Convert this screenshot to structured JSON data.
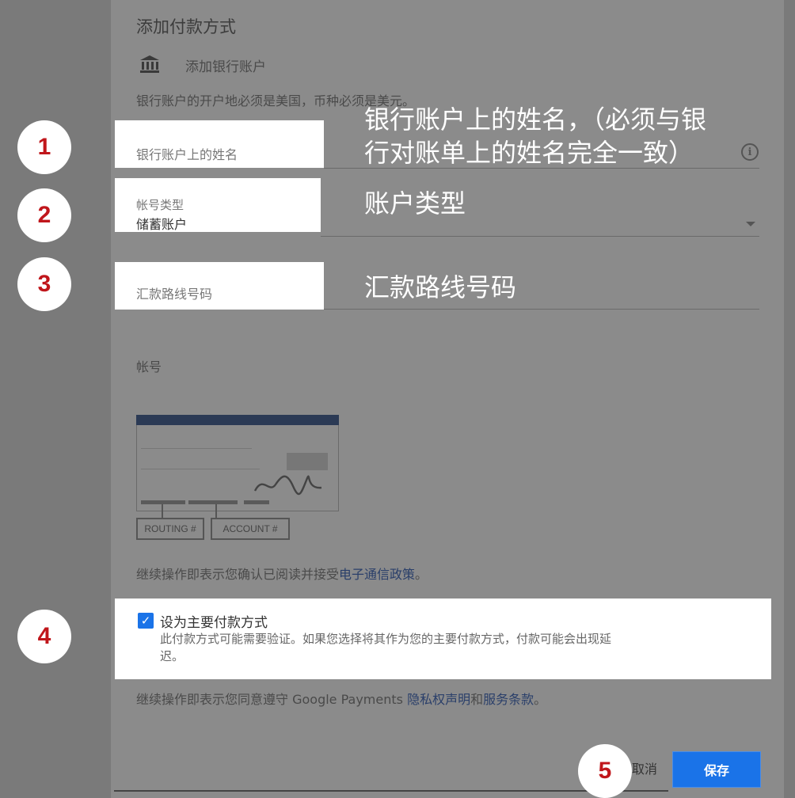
{
  "dialog": {
    "title": "添加付款方式",
    "bank_option": {
      "icon": "bank-icon",
      "label": "添加银行账户"
    },
    "notice": "银行账户的开户地必须是美国，币种必须是美元。"
  },
  "fields": {
    "account_holder": {
      "label": "银行账户上的姓名",
      "info_icon": "info-icon"
    },
    "account_type": {
      "label": "帐号类型",
      "value": "储蓄账户",
      "icon": "dropdown-arrow-icon"
    },
    "routing_number": {
      "label": "汇款路线号码"
    },
    "account_number": {
      "label": "帐号"
    }
  },
  "check_illustration": {
    "routing_tag": "ROUTING #",
    "account_tag": "ACCOUNT #"
  },
  "consent_1": {
    "prefix": "继续操作即表示您确认已阅读并接受",
    "link": "电子通信政策",
    "suffix": "。"
  },
  "primary_option": {
    "checked": true,
    "label": "设为主要付款方式",
    "description_line1": "此付款方式可能需要验证。如果您选择将其作为您的主要付款方式，付款可能会出现延",
    "description_line2": "迟。"
  },
  "consent_2": {
    "prefix": "继续操作即表示您同意遵守 Google Payments ",
    "link1": "隐私权声明",
    "middle": "和",
    "link2": "服务条款",
    "suffix": "。"
  },
  "buttons": {
    "cancel": "取消",
    "save": "保存"
  },
  "annotations": {
    "badge1": "1",
    "badge2": "2",
    "badge3": "3",
    "badge4": "4",
    "badge5": "5",
    "note1_line1": "银行账户上的姓名，（必须与银",
    "note1_line2": "行对账单上的姓名完全一致）",
    "note2": "账户类型",
    "note3": "汇款路线号码"
  },
  "colors": {
    "badge_text": "#c0161b",
    "primary_blue": "#1a73e8",
    "overlay": "#8b8b8b"
  }
}
